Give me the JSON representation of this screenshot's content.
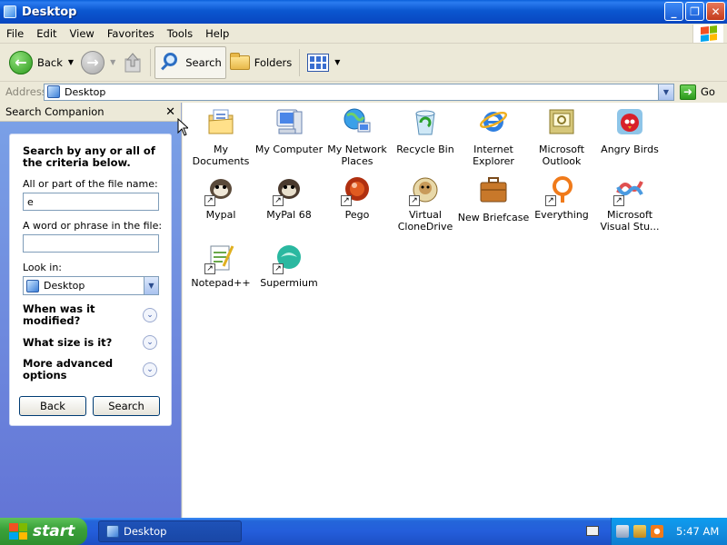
{
  "window": {
    "title": "Desktop"
  },
  "menu": [
    "File",
    "Edit",
    "View",
    "Favorites",
    "Tools",
    "Help"
  ],
  "toolbar": {
    "back": "Back",
    "search": "Search",
    "folders": "Folders"
  },
  "address": {
    "label": "Address",
    "value": "Desktop",
    "go": "Go"
  },
  "companion": {
    "title": "Search Companion",
    "heading": "Search by any or all of the criteria below.",
    "filename_label": "All or part of the file name:",
    "filename_value": "e",
    "phrase_label": "A word or phrase in the file:",
    "phrase_value": "",
    "lookin_label": "Look in:",
    "lookin_value": "Desktop",
    "expanders": [
      "When was it modified?",
      "What size is it?",
      "More advanced options"
    ],
    "back_button": "Back",
    "search_button": "Search"
  },
  "icons": [
    {
      "label": "My Documents",
      "icon": "my-documents-icon"
    },
    {
      "label": "My Computer",
      "icon": "my-computer-icon"
    },
    {
      "label": "My Network Places",
      "icon": "network-places-icon"
    },
    {
      "label": "Recycle Bin",
      "icon": "recycle-bin-icon"
    },
    {
      "label": "Internet Explorer",
      "icon": "internet-explorer-icon"
    },
    {
      "label": "Microsoft Outlook",
      "icon": "outlook-icon"
    },
    {
      "label": "Angry Birds",
      "icon": "angry-birds-icon"
    },
    {
      "label": "Mypal",
      "icon": "mypal-icon"
    },
    {
      "label": "MyPal 68",
      "icon": "mypal68-icon"
    },
    {
      "label": "Pego",
      "icon": "pego-icon"
    },
    {
      "label": "Virtual CloneDrive",
      "icon": "clonedrive-icon"
    },
    {
      "label": "New Briefcase",
      "icon": "briefcase-icon"
    },
    {
      "label": "Everything",
      "icon": "everything-icon"
    },
    {
      "label": "Microsoft Visual Stu...",
      "icon": "visual-studio-icon"
    },
    {
      "label": "Notepad++",
      "icon": "notepadpp-icon"
    },
    {
      "label": "Supermium",
      "icon": "supermium-icon"
    }
  ],
  "taskbar": {
    "start": "start",
    "task": "Desktop",
    "clock": "5:47 AM"
  }
}
